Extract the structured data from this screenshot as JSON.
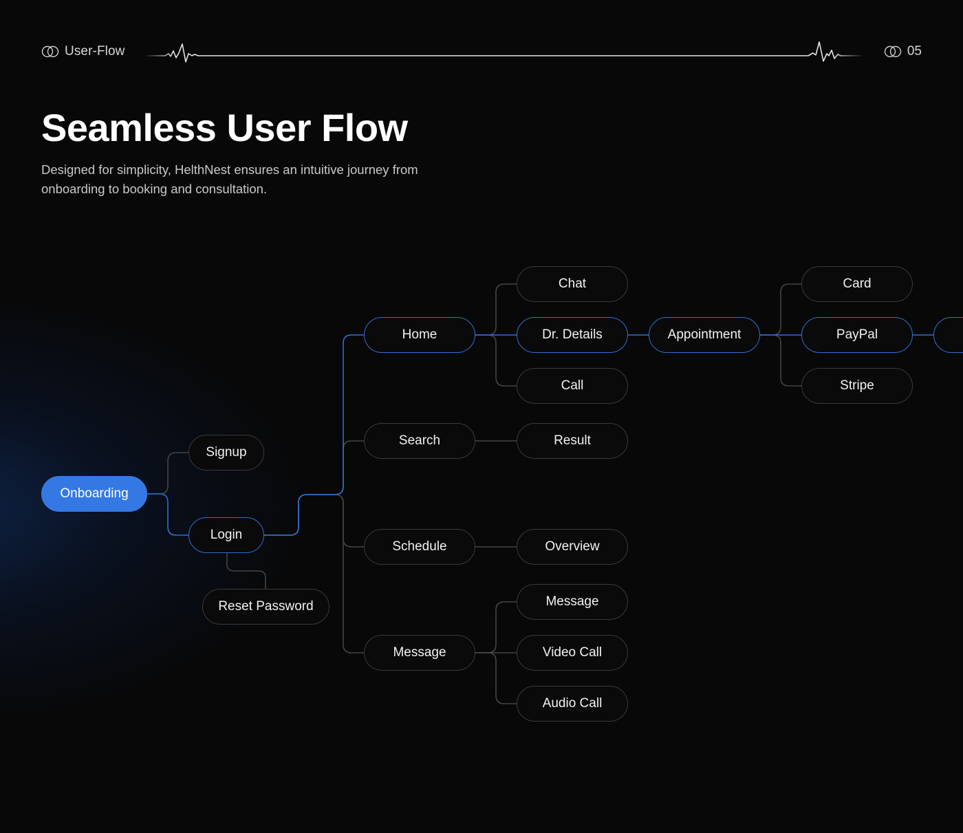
{
  "header": {
    "section_icon": "overlapping-rings-icon",
    "section_label": "User-Flow",
    "page_number": "05",
    "decoration": "heartbeat-line"
  },
  "hero": {
    "title": "Seamless User Flow",
    "subtitle": "Designed for simplicity, HelthNest ensures an intuitive journey from onboarding to booking and consultation."
  },
  "colors": {
    "background": "#080808",
    "accent": "#3479e3",
    "active_stroke": "#2f6fd6",
    "inactive_stroke": "#3a3a3a",
    "connector_gray": "#444444"
  },
  "flow": {
    "nodes": [
      {
        "id": "onboarding",
        "label": "Onboarding",
        "state": "primary"
      },
      {
        "id": "signup",
        "label": "Signup",
        "state": "default"
      },
      {
        "id": "login",
        "label": "Login",
        "state": "active"
      },
      {
        "id": "reset-password",
        "label": "Reset Password",
        "state": "default"
      },
      {
        "id": "home",
        "label": "Home",
        "state": "active"
      },
      {
        "id": "search",
        "label": "Search",
        "state": "default"
      },
      {
        "id": "schedule",
        "label": "Schedule",
        "state": "default"
      },
      {
        "id": "message",
        "label": "Message",
        "state": "default"
      },
      {
        "id": "chat",
        "label": "Chat",
        "state": "default"
      },
      {
        "id": "dr-details",
        "label": "Dr. Details",
        "state": "active"
      },
      {
        "id": "call",
        "label": "Call",
        "state": "default"
      },
      {
        "id": "result",
        "label": "Result",
        "state": "default"
      },
      {
        "id": "overview",
        "label": "Overview",
        "state": "default"
      },
      {
        "id": "message-sub",
        "label": "Message",
        "state": "default"
      },
      {
        "id": "video-call",
        "label": "Video Call",
        "state": "default"
      },
      {
        "id": "audio-call",
        "label": "Audio Call",
        "state": "default"
      },
      {
        "id": "appointment",
        "label": "Appointment",
        "state": "active"
      },
      {
        "id": "card",
        "label": "Card",
        "state": "default"
      },
      {
        "id": "paypal",
        "label": "PayPal",
        "state": "active"
      },
      {
        "id": "stripe",
        "label": "Stripe",
        "state": "default"
      },
      {
        "id": "next-offscreen",
        "label": "",
        "state": "active"
      }
    ],
    "edges": [
      {
        "from": "onboarding",
        "to": "signup",
        "active": false
      },
      {
        "from": "onboarding",
        "to": "login",
        "active": true
      },
      {
        "from": "login",
        "to": "reset-password",
        "active": false
      },
      {
        "from": "login",
        "to": "home",
        "active": true
      },
      {
        "from": "login",
        "to": "search",
        "active": false
      },
      {
        "from": "login",
        "to": "schedule",
        "active": false
      },
      {
        "from": "login",
        "to": "message",
        "active": false
      },
      {
        "from": "home",
        "to": "chat",
        "active": false
      },
      {
        "from": "home",
        "to": "dr-details",
        "active": true
      },
      {
        "from": "home",
        "to": "call",
        "active": false
      },
      {
        "from": "search",
        "to": "result",
        "active": false
      },
      {
        "from": "schedule",
        "to": "overview",
        "active": false
      },
      {
        "from": "message",
        "to": "message-sub",
        "active": false
      },
      {
        "from": "message",
        "to": "video-call",
        "active": false
      },
      {
        "from": "message",
        "to": "audio-call",
        "active": false
      },
      {
        "from": "dr-details",
        "to": "appointment",
        "active": true
      },
      {
        "from": "appointment",
        "to": "card",
        "active": false
      },
      {
        "from": "appointment",
        "to": "paypal",
        "active": true
      },
      {
        "from": "appointment",
        "to": "stripe",
        "active": false
      },
      {
        "from": "paypal",
        "to": "next-offscreen",
        "active": true
      }
    ]
  }
}
